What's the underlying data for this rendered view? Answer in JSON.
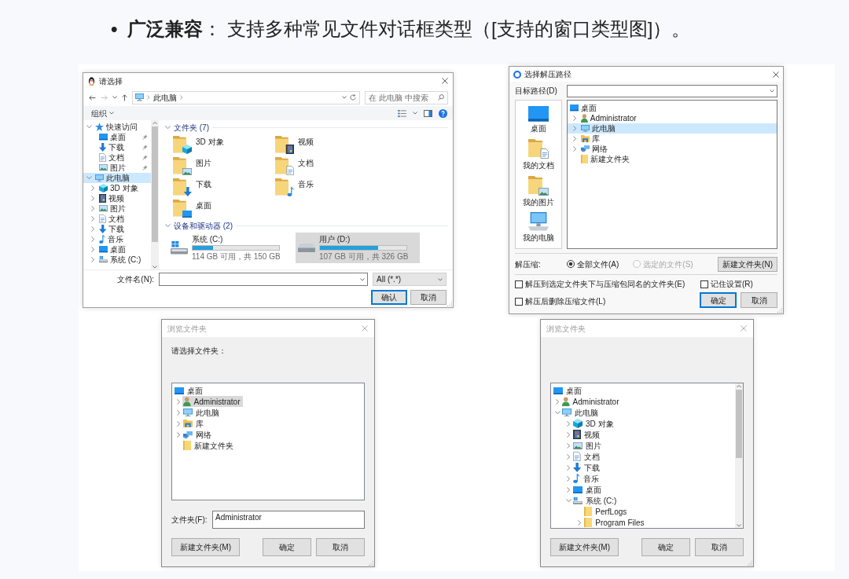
{
  "heading": {
    "marker": "•",
    "text": "**广泛兼容**： 支持多种常见文件对话框类型（[支持的窗口类型图]）。"
  },
  "open_dialog": {
    "title": "请选择",
    "active": true,
    "path": [
      "此电脑"
    ],
    "search": {
      "placeholder": "在 此电脑 中搜索"
    },
    "organize": "组织",
    "nav_tree": [
      {
        "label": "快速访问",
        "kind": "quick",
        "expanded": true,
        "selected": false,
        "children": [
          {
            "label": "桌面",
            "kind": "desktop",
            "pinned": true,
            "selected": false
          },
          {
            "label": "下载",
            "kind": "downloads",
            "pinned": true,
            "selected": false
          },
          {
            "label": "文档",
            "kind": "documents",
            "pinned": true,
            "selected": false
          },
          {
            "label": "图片",
            "kind": "pictures",
            "pinned": true,
            "selected": false
          }
        ]
      },
      {
        "label": "此电脑",
        "kind": "pc",
        "expanded": true,
        "selected": true,
        "children": [
          {
            "label": "3D 对象",
            "kind": "objects3d",
            "expanded": false,
            "selected": false
          },
          {
            "label": "视频",
            "kind": "videos",
            "expanded": false,
            "selected": false
          },
          {
            "label": "图片",
            "kind": "pictures",
            "expanded": false,
            "selected": false
          },
          {
            "label": "文档",
            "kind": "documents",
            "expanded": false,
            "selected": false
          },
          {
            "label": "下载",
            "kind": "downloads",
            "expanded": false,
            "selected": false
          },
          {
            "label": "音乐",
            "kind": "music",
            "expanded": false,
            "selected": false
          },
          {
            "label": "桌面",
            "kind": "desktop",
            "expanded": false,
            "selected": false
          },
          {
            "label": "系统 (C:)",
            "kind": "system",
            "expanded": false,
            "selected": false
          }
        ]
      }
    ],
    "folders": {
      "heading": "文件夹 (7)",
      "expanded": true,
      "items": [
        {
          "label": "3D 对象",
          "kind": "objects3d",
          "selected": false
        },
        {
          "label": "视频",
          "kind": "videos",
          "selected": false
        },
        {
          "label": "图片",
          "kind": "pictures",
          "selected": false
        },
        {
          "label": "文档",
          "kind": "documents",
          "selected": false
        },
        {
          "label": "下载",
          "kind": "downloads",
          "selected": false
        },
        {
          "label": "音乐",
          "kind": "music",
          "selected": false
        },
        {
          "label": "桌面",
          "kind": "desktop",
          "selected": false
        }
      ]
    },
    "drives": {
      "heading": "设备和驱动器 (2)",
      "expanded": true,
      "items": [
        {
          "label": "系统 (C:)",
          "kind": "system",
          "level": 0.24,
          "reading": "114 GB 可用，共 150 GB",
          "selected": false
        },
        {
          "label": "用户 (D:)",
          "kind": "disk",
          "level": 0.67,
          "reading": "107 GB 可用，共 326 GB",
          "selected": true
        }
      ]
    },
    "filename": {
      "label": "文件名(N):"
    },
    "file_type": "All (*.*)",
    "buttons": [
      {
        "label": "确认",
        "default": true
      },
      {
        "label": "取消",
        "default": false
      }
    ]
  },
  "extract_dialog": {
    "title": "选择解压路径",
    "active": true,
    "target": {
      "label": "目标路径(D)"
    },
    "places": [
      {
        "label": "桌面",
        "kind": "desktop"
      },
      {
        "label": "我的文档",
        "kind": "documents"
      },
      {
        "label": "我的图片",
        "kind": "pictures"
      },
      {
        "label": "我的电脑",
        "kind": "computer"
      }
    ],
    "tree": [
      {
        "label": "桌面",
        "kind": "desktop",
        "selected": false,
        "children": [
          {
            "label": "Administrator",
            "kind": "user",
            "expanded": false,
            "selected": false
          },
          {
            "label": "此电脑",
            "kind": "pc",
            "expanded": false,
            "selected": true
          },
          {
            "label": "库",
            "kind": "library",
            "expanded": false,
            "selected": false
          },
          {
            "label": "网络",
            "kind": "network",
            "expanded": false,
            "selected": false
          },
          {
            "label": "新建文件夹",
            "kind": "folder",
            "selected": false
          }
        ]
      }
    ],
    "extract_label": "解压缩:",
    "radios": [
      {
        "label": "全部文件(A)",
        "selected": true,
        "disabled": false
      },
      {
        "label": "选定的文件(S)",
        "selected": false,
        "disabled": true
      }
    ],
    "new_folder_button": {
      "label": "新建文件夹(N)",
      "default": false
    },
    "checkboxes": [
      {
        "label": "解压到选定文件夹下与压缩包同名的文件夹(E)",
        "checked": false
      },
      {
        "label": "解压后删除压缩文件(L)",
        "checked": false
      }
    ],
    "remember": {
      "label": "记住设置(R)",
      "checked": false
    },
    "buttons": [
      {
        "label": "确定",
        "default": true
      },
      {
        "label": "取消",
        "default": false
      }
    ]
  },
  "browse_dialogs": [
    {
      "title": "浏览文件夹",
      "active": false,
      "prompt": "请选择文件夹：",
      "tree": [
        {
          "label": "桌面",
          "kind": "desktop",
          "selected": false,
          "children": [
            {
              "label": "Administrator",
              "kind": "user",
              "expanded": false,
              "selected": true
            },
            {
              "label": "此电脑",
              "kind": "pc",
              "expanded": false,
              "selected": false
            },
            {
              "label": "库",
              "kind": "library",
              "expanded": false,
              "selected": false
            },
            {
              "label": "网络",
              "kind": "network",
              "expanded": false,
              "selected": false
            },
            {
              "label": "新建文件夹",
              "kind": "folder",
              "selected": false
            }
          ]
        }
      ],
      "folder_field": {
        "label": "文件夹(F):",
        "value": "Administrator"
      },
      "buttons": [
        {
          "label": "新建文件夹(M)",
          "default": false
        },
        {
          "label": "确定",
          "default": false
        },
        {
          "label": "取消",
          "default": false
        }
      ]
    },
    {
      "title": "浏览文件夹",
      "active": false,
      "tree": [
        {
          "label": "桌面",
          "kind": "desktop",
          "selected": false,
          "children": [
            {
              "label": "Administrator",
              "kind": "user",
              "expanded": false,
              "selected": false
            },
            {
              "label": "此电脑",
              "kind": "pc",
              "expanded": true,
              "selected": false,
              "children": [
                {
                  "label": "3D 对象",
                  "kind": "objects3d",
                  "expanded": false,
                  "selected": false
                },
                {
                  "label": "视频",
                  "kind": "videos",
                  "expanded": false,
                  "selected": false
                },
                {
                  "label": "图片",
                  "kind": "pictures",
                  "expanded": false,
                  "selected": false
                },
                {
                  "label": "文档",
                  "kind": "documents",
                  "expanded": false,
                  "selected": false
                },
                {
                  "label": "下载",
                  "kind": "downloads",
                  "expanded": false,
                  "selected": false
                },
                {
                  "label": "音乐",
                  "kind": "music",
                  "expanded": false,
                  "selected": false
                },
                {
                  "label": "桌面",
                  "kind": "desktop",
                  "expanded": false,
                  "selected": false
                },
                {
                  "label": "系统 (C:)",
                  "kind": "system",
                  "expanded": true,
                  "selected": false,
                  "children": [
                    {
                      "label": "PerfLogs",
                      "kind": "folder",
                      "selected": false
                    },
                    {
                      "label": "Program Files",
                      "kind": "folder",
                      "expanded": false,
                      "selected": false
                    }
                  ]
                }
              ]
            }
          ]
        }
      ],
      "buttons": [
        {
          "label": "新建文件夹(M)",
          "default": false
        },
        {
          "label": "确定",
          "default": false
        },
        {
          "label": "取消",
          "default": false
        }
      ]
    }
  ]
}
